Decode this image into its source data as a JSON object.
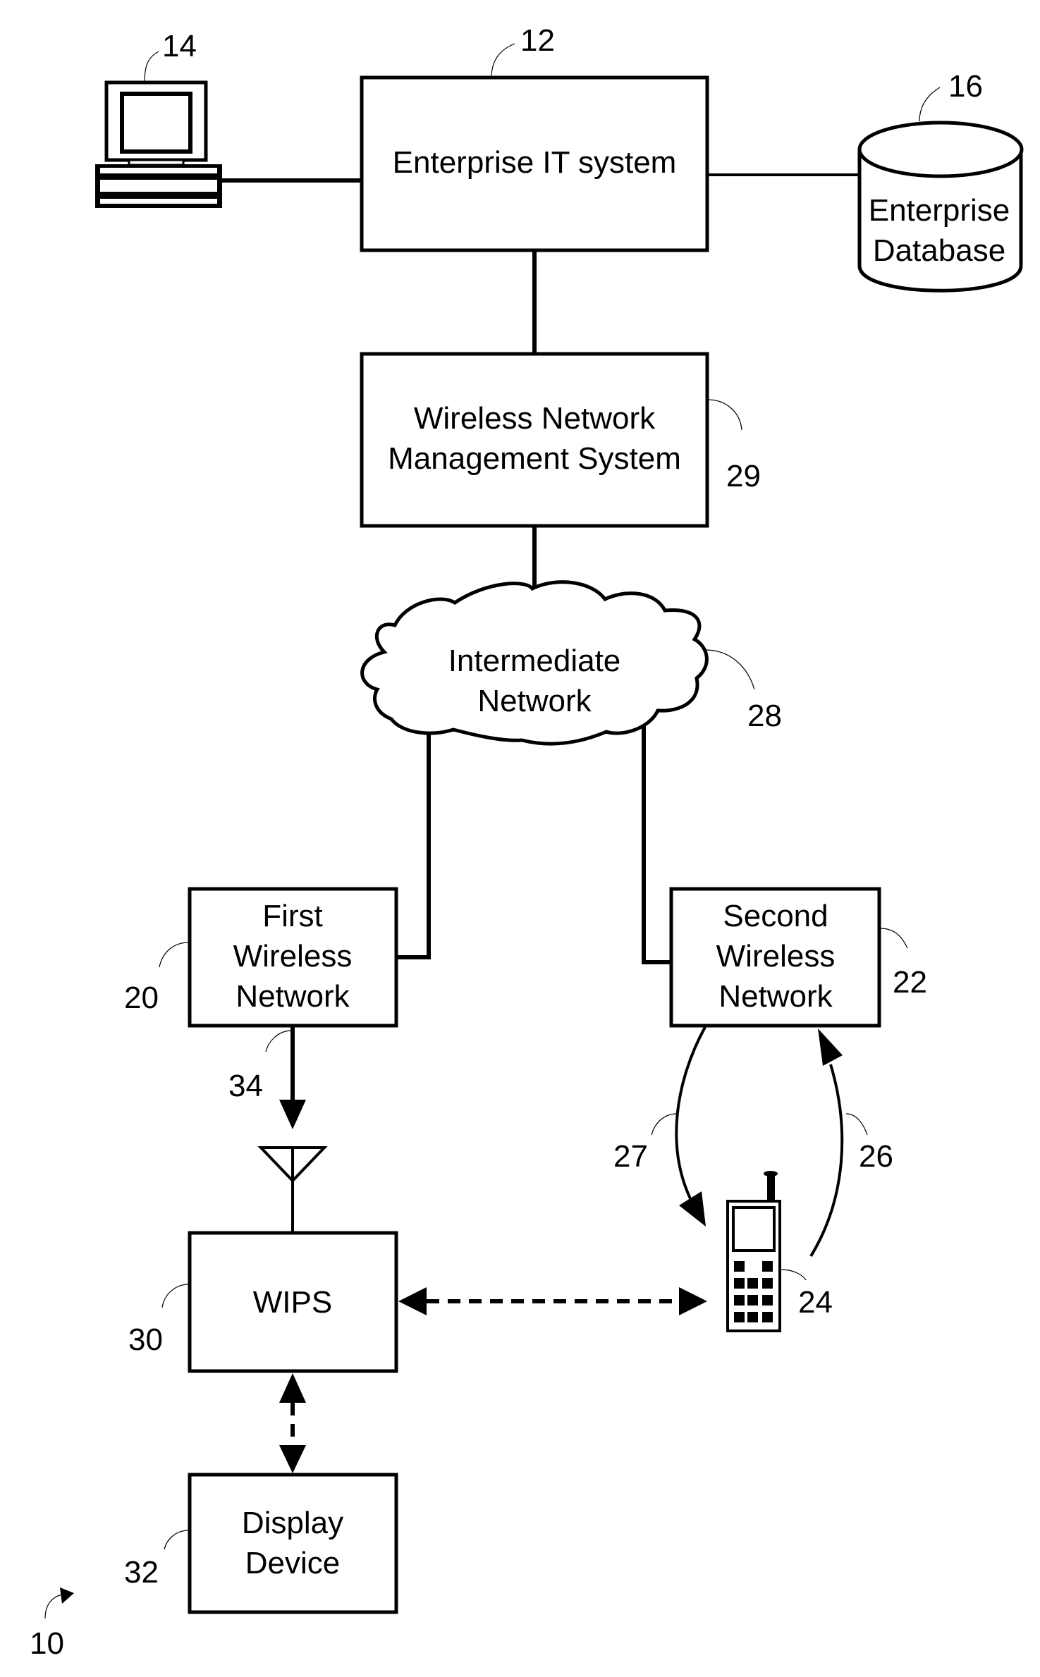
{
  "figure": {
    "figure_ref": "10",
    "nodes": {
      "enterprise_it": {
        "ref": "12",
        "lines": [
          "Enterprise IT system"
        ]
      },
      "workstation": {
        "ref": "14",
        "icon": "computer-icon"
      },
      "database": {
        "ref": "16",
        "lines": [
          "Enterprise",
          "Database"
        ]
      },
      "wnms": {
        "ref": "29",
        "lines": [
          "Wireless Network",
          "Management System"
        ]
      },
      "intermediate": {
        "ref": "28",
        "lines": [
          "Intermediate",
          "Network"
        ]
      },
      "first_wn": {
        "ref": "20",
        "lines": [
          "First",
          "Wireless",
          "Network"
        ]
      },
      "second_wn": {
        "ref": "22",
        "lines": [
          "Second",
          "Wireless",
          "Network"
        ]
      },
      "wips": {
        "ref": "30",
        "lines": [
          "WIPS"
        ]
      },
      "display": {
        "ref": "32",
        "lines": [
          "Display",
          "Device"
        ]
      },
      "mobile": {
        "ref": "24",
        "icon": "mobile-phone-icon"
      }
    },
    "links": {
      "first_to_wips": {
        "ref": "34"
      },
      "second_to_mobile": {
        "ref": "27"
      },
      "mobile_to_second": {
        "ref": "26"
      }
    }
  }
}
